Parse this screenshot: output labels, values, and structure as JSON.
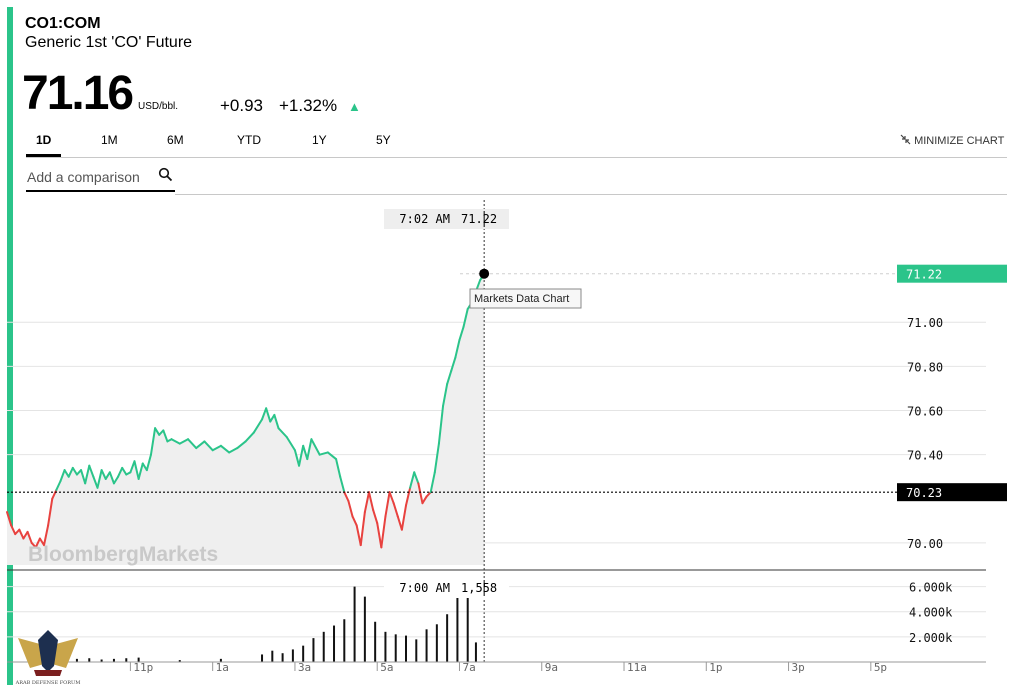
{
  "header": {
    "ticker": "CO1:COM",
    "name": "Generic 1st 'CO' Future",
    "price": "71.16",
    "unit": "USD/bbl.",
    "change": "+0.93",
    "change_pct": "+1.32%",
    "up_arrow": "▲"
  },
  "tabs": [
    {
      "label": "1D",
      "active": true
    },
    {
      "label": "1M",
      "active": false
    },
    {
      "label": "6M",
      "active": false
    },
    {
      "label": "YTD",
      "active": false
    },
    {
      "label": "1Y",
      "active": false
    },
    {
      "label": "5Y",
      "active": false
    }
  ],
  "minimize_label": "MINIMIZE CHART",
  "comparison": {
    "placeholder": "Add a comparison"
  },
  "colors": {
    "accent": "#2bc48a",
    "up": "#2bc48a",
    "down": "#e8423f",
    "area": "#efefef",
    "prev_close_bg": "#000000"
  },
  "watermark": "BloombergMarkets",
  "tooltip": "Markets Data Chart",
  "crosshair": {
    "price_time": "7:02 AM",
    "price_value": "71.22",
    "volume_time": "7:00 AM",
    "volume_value": "1,558"
  },
  "logo_text": "ARAB DEFENSE FORUM",
  "chart_data": [
    {
      "type": "line",
      "y_ticks": [
        "71.00",
        "70.80",
        "70.60",
        "70.40",
        "70.00"
      ],
      "y_tick_values": [
        71.0,
        70.8,
        70.6,
        70.4,
        70.0
      ],
      "ylim": [
        69.9,
        71.35
      ],
      "current_label": "71.22",
      "current_value": 71.22,
      "prev_close_label": "70.23",
      "prev_close_value": 70.23,
      "x_labels": [
        "11p",
        "1a",
        "3a",
        "5a",
        "7a",
        "9a",
        "11a",
        "1p",
        "3p",
        "5p"
      ],
      "x_positions": [
        3,
        5,
        7,
        9,
        11,
        13,
        15,
        17,
        19,
        21
      ],
      "xlim": [
        0,
        23.8
      ],
      "grid": true,
      "series": [
        {
          "values": [
            [
              0.0,
              70.14
            ],
            [
              0.1,
              70.08
            ],
            [
              0.2,
              70.04
            ],
            [
              0.3,
              70.06
            ],
            [
              0.4,
              70.02
            ],
            [
              0.5,
              70.05
            ],
            [
              0.6,
              70.0
            ],
            [
              0.7,
              69.98
            ],
            [
              0.8,
              70.02
            ],
            [
              0.9,
              69.99
            ],
            [
              1.0,
              70.08
            ],
            [
              1.1,
              70.2
            ],
            [
              1.2,
              70.24
            ],
            [
              1.3,
              70.28
            ],
            [
              1.4,
              70.33
            ],
            [
              1.5,
              70.3
            ],
            [
              1.6,
              70.34
            ],
            [
              1.7,
              70.31
            ],
            [
              1.8,
              70.33
            ],
            [
              1.9,
              70.27
            ],
            [
              2.0,
              70.35
            ],
            [
              2.1,
              70.3
            ],
            [
              2.2,
              70.25
            ],
            [
              2.3,
              70.33
            ],
            [
              2.4,
              70.29
            ],
            [
              2.5,
              70.32
            ],
            [
              2.6,
              70.27
            ],
            [
              2.7,
              70.3
            ],
            [
              2.8,
              70.34
            ],
            [
              2.9,
              70.31
            ],
            [
              3.0,
              70.32
            ],
            [
              3.1,
              70.37
            ],
            [
              3.2,
              70.29
            ],
            [
              3.3,
              70.36
            ],
            [
              3.4,
              70.33
            ],
            [
              3.5,
              70.4
            ],
            [
              3.6,
              70.52
            ],
            [
              3.7,
              70.49
            ],
            [
              3.8,
              70.51
            ],
            [
              3.9,
              70.46
            ],
            [
              4.0,
              70.47
            ],
            [
              4.2,
              70.45
            ],
            [
              4.4,
              70.47
            ],
            [
              4.6,
              70.43
            ],
            [
              4.8,
              70.46
            ],
            [
              5.0,
              70.42
            ],
            [
              5.2,
              70.44
            ],
            [
              5.4,
              70.41
            ],
            [
              5.6,
              70.43
            ],
            [
              5.8,
              70.46
            ],
            [
              6.0,
              70.5
            ],
            [
              6.2,
              70.56
            ],
            [
              6.3,
              70.61
            ],
            [
              6.4,
              70.55
            ],
            [
              6.5,
              70.58
            ],
            [
              6.6,
              70.52
            ],
            [
              6.8,
              70.48
            ],
            [
              7.0,
              70.42
            ],
            [
              7.1,
              70.35
            ],
            [
              7.2,
              70.44
            ],
            [
              7.3,
              70.38
            ],
            [
              7.4,
              70.47
            ],
            [
              7.6,
              70.4
            ],
            [
              7.8,
              70.41
            ],
            [
              8.0,
              70.38
            ],
            [
              8.1,
              70.3
            ],
            [
              8.2,
              70.23
            ],
            [
              8.3,
              70.19
            ],
            [
              8.4,
              70.12
            ],
            [
              8.5,
              70.08
            ],
            [
              8.6,
              69.99
            ],
            [
              8.7,
              70.14
            ],
            [
              8.8,
              70.23
            ],
            [
              8.9,
              70.15
            ],
            [
              9.0,
              70.09
            ],
            [
              9.1,
              69.98
            ],
            [
              9.2,
              70.12
            ],
            [
              9.3,
              70.23
            ],
            [
              9.4,
              70.18
            ],
            [
              9.5,
              70.12
            ],
            [
              9.6,
              70.06
            ],
            [
              9.7,
              70.17
            ],
            [
              9.8,
              70.25
            ],
            [
              9.9,
              70.32
            ],
            [
              10.0,
              70.27
            ],
            [
              10.1,
              70.18
            ],
            [
              10.2,
              70.21
            ],
            [
              10.3,
              70.23
            ],
            [
              10.4,
              70.32
            ],
            [
              10.5,
              70.45
            ],
            [
              10.6,
              70.62
            ],
            [
              10.7,
              70.72
            ],
            [
              10.8,
              70.78
            ],
            [
              10.9,
              70.84
            ],
            [
              11.0,
              70.92
            ],
            [
              11.1,
              70.98
            ],
            [
              11.2,
              71.06
            ],
            [
              11.3,
              71.09
            ],
            [
              11.4,
              71.14
            ],
            [
              11.5,
              71.19
            ],
            [
              11.6,
              71.22
            ]
          ]
        }
      ]
    },
    {
      "type": "bar",
      "y_ticks": [
        "6.000k",
        "4.000k",
        "2.000k"
      ],
      "y_tick_values": [
        6000,
        4000,
        2000
      ],
      "ylim": [
        0,
        7000
      ],
      "xlim": [
        0,
        23.8
      ],
      "x": [
        1.7,
        2.0,
        2.3,
        2.6,
        2.9,
        3.2,
        4.2,
        5.2,
        6.2,
        6.45,
        6.7,
        6.95,
        7.2,
        7.45,
        7.7,
        7.95,
        8.2,
        8.45,
        8.7,
        8.95,
        9.2,
        9.45,
        9.7,
        9.95,
        10.2,
        10.45,
        10.7,
        10.95,
        11.2,
        11.4
      ],
      "values": [
        250,
        300,
        200,
        250,
        300,
        350,
        150,
        250,
        600,
        900,
        700,
        1000,
        1300,
        1900,
        2400,
        2900,
        3400,
        6000,
        5200,
        3200,
        2400,
        2200,
        2100,
        1800,
        2600,
        3000,
        3800,
        5300,
        5400,
        1558
      ]
    }
  ]
}
